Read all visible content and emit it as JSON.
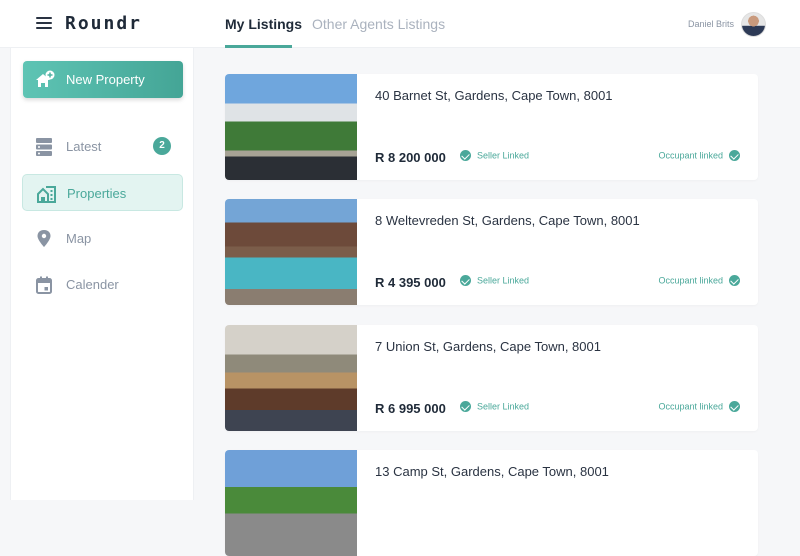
{
  "app": {
    "brand": "Roundr"
  },
  "header": {
    "tabs": [
      {
        "label": "My Listings",
        "active": true
      },
      {
        "label": "Other Agents Listings",
        "active": false
      }
    ],
    "user": {
      "name": "Daniel Brits"
    }
  },
  "sidebar": {
    "new_button": "New Property",
    "items": [
      {
        "label": "Latest",
        "icon": "server-stack-icon",
        "badge": "2"
      },
      {
        "label": "Properties",
        "icon": "buildings-icon",
        "active": true
      },
      {
        "label": "Map",
        "icon": "map-pin-icon"
      },
      {
        "label": "Calender",
        "icon": "calendar-icon"
      }
    ]
  },
  "listings": [
    {
      "address": "40 Barnet St, Gardens, Cape Town, 8001",
      "price": "R 8 200 000",
      "seller": "Seller Linked",
      "occupant": "Occupant linked"
    },
    {
      "address": "8 Weltevreden St, Gardens, Cape Town, 8001",
      "price": "R 4 395 000",
      "seller": "Seller Linked",
      "occupant": "Occupant linked"
    },
    {
      "address": "7 Union St, Gardens, Cape Town, 8001",
      "price": "R 6 995 000",
      "seller": "Seller Linked",
      "occupant": "Occupant linked"
    },
    {
      "address": "13 Camp St, Gardens, Cape Town, 8001"
    }
  ],
  "colors": {
    "accent": "#4aa89a",
    "active_bg": "#e3f4f1"
  }
}
